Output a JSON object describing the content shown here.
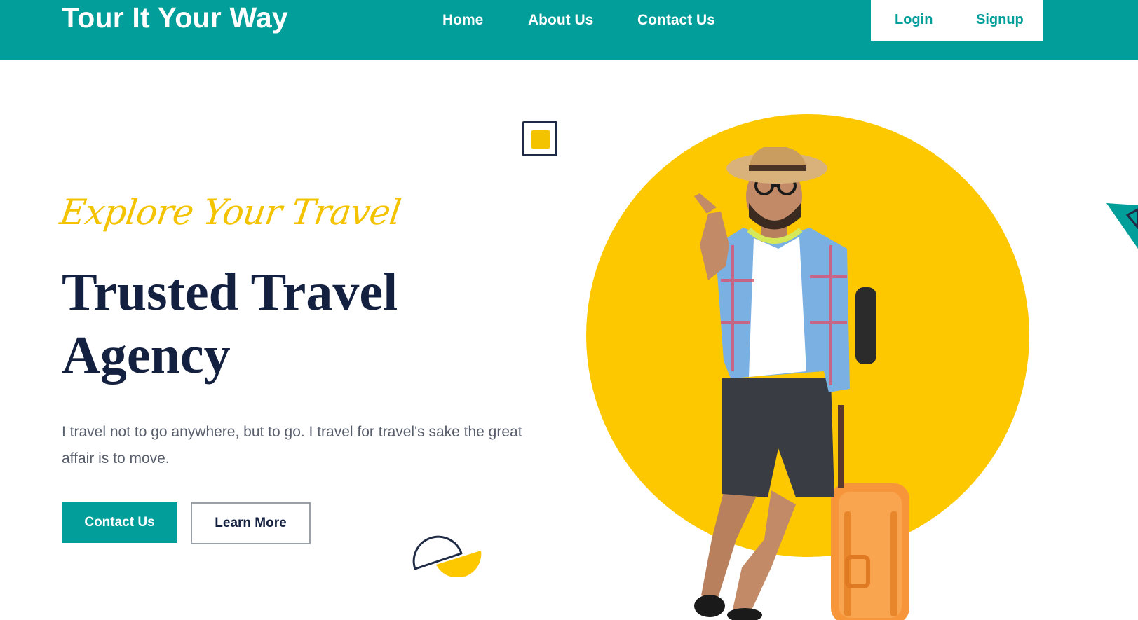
{
  "header": {
    "brand": "Tour It Your Way",
    "nav": [
      "Home",
      "About Us",
      "Contact Us"
    ],
    "login": "Login",
    "signup": "Signup"
  },
  "hero": {
    "tagline": "Explore Your Travel",
    "headline_line1": "Trusted Travel",
    "headline_line2": "Agency",
    "description": "I travel not to go anywhere, but to go. I travel for travel's sake the great affair is to move.",
    "primary_button": "Contact Us",
    "secondary_button": "Learn More"
  },
  "colors": {
    "teal": "#029e9a",
    "yellow": "#fdc800",
    "navy": "#14203f"
  }
}
